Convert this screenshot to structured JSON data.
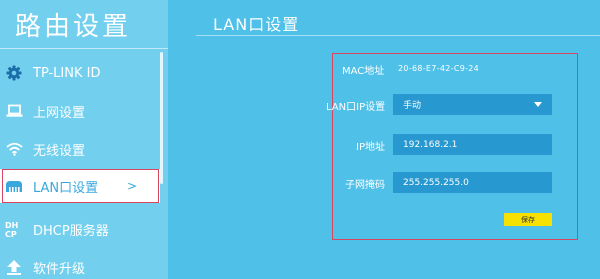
{
  "app": {
    "title": "路由设置"
  },
  "sidebar": {
    "items": [
      {
        "label": "TP-LINK ID",
        "icon": "gear-icon"
      },
      {
        "label": "上网设置",
        "icon": "laptop-icon"
      },
      {
        "label": "无线设置",
        "icon": "wifi-icon"
      },
      {
        "label": "LAN口设置",
        "icon": "lan-port-icon",
        "chevron": ">"
      },
      {
        "label": "DHCP服务器",
        "icon": "dhcp-icon"
      },
      {
        "label": "软件升级",
        "icon": "upload-arrow-icon"
      }
    ]
  },
  "main": {
    "title": "LAN口设置",
    "mac": {
      "label": "MAC地址",
      "value": "20-68-E7-42-C9-24"
    },
    "lan_ip_setting": {
      "label": "LAN口IP设置",
      "value": "手动"
    },
    "ip": {
      "label": "IP地址",
      "value": "192.168.2.1"
    },
    "mask": {
      "label": "子网掩码",
      "value": "255.255.255.0"
    },
    "save_label": "保存"
  },
  "colors": {
    "background": "#4fc0e8",
    "sidebar": "#72cfee",
    "field": "#2799d0",
    "save_button": "#f6e100",
    "highlight_outline": "#d9455f"
  }
}
